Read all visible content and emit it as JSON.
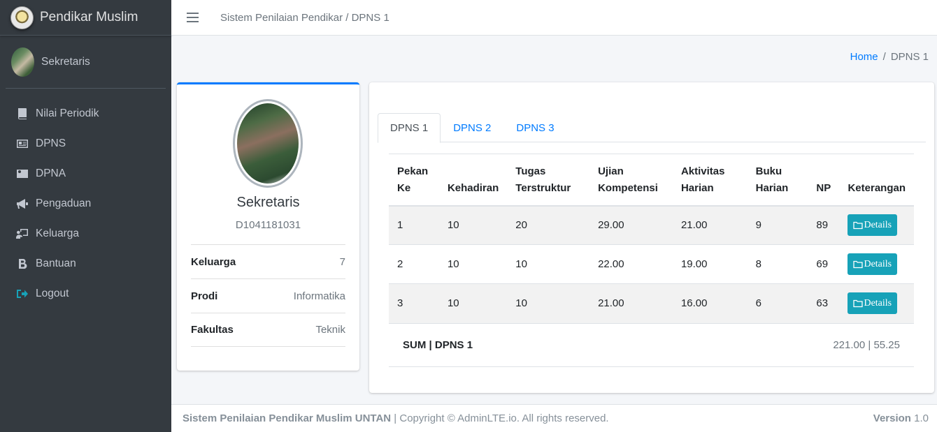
{
  "brand": {
    "name": "Pendikar Muslim",
    "logo_icon": "university-seal-icon"
  },
  "user_panel": {
    "name": "Sekretaris"
  },
  "sidebar": {
    "items": [
      {
        "label": "Nilai Periodik",
        "icon": "book-icon"
      },
      {
        "label": "DPNS",
        "icon": "id-card-icon"
      },
      {
        "label": "DPNA",
        "icon": "id-badge-icon"
      },
      {
        "label": "Pengaduan",
        "icon": "bullhorn-icon"
      },
      {
        "label": "Keluarga",
        "icon": "chalkboard-user-icon"
      },
      {
        "label": "Bantuan",
        "icon": "bold-b-icon"
      },
      {
        "label": "Logout",
        "icon": "sign-out-icon"
      }
    ]
  },
  "topbar": {
    "title": "Sistem Penilaian Pendikar / DPNS 1"
  },
  "breadcrumb": {
    "home": "Home",
    "separator": "/",
    "current": "DPNS 1"
  },
  "profile": {
    "name": "Sekretaris",
    "id": "D1041181031",
    "rows": [
      {
        "key": "Keluarga",
        "value": "7"
      },
      {
        "key": "Prodi",
        "value": "Informatika"
      },
      {
        "key": "Fakultas",
        "value": "Teknik"
      }
    ]
  },
  "tabs": [
    {
      "label": "DPNS 1",
      "active": true
    },
    {
      "label": "DPNS 2",
      "active": false
    },
    {
      "label": "DPNS 3",
      "active": false
    }
  ],
  "table": {
    "headers": [
      "Pekan Ke",
      "Kehadiran",
      "Tugas Terstruktur",
      "Ujian Kompetensi",
      "Aktivitas Harian",
      "Buku Harian",
      "NP",
      "Keterangan"
    ],
    "header_lines": [
      [
        "Pekan",
        "Ke"
      ],
      [
        "",
        "Kehadiran"
      ],
      [
        "Tugas",
        "Terstruktur"
      ],
      [
        "Ujian",
        "Kompetensi"
      ],
      [
        "Aktivitas",
        "Harian"
      ],
      [
        "Buku",
        "Harian"
      ],
      [
        "",
        "NP"
      ],
      [
        "",
        "Keterangan"
      ]
    ],
    "rows": [
      {
        "pekan": "1",
        "kehadiran": "10",
        "tugas": "20",
        "ujian": "29.00",
        "aktivitas": "21.00",
        "buku": "9",
        "np": "89",
        "button": "Details"
      },
      {
        "pekan": "2",
        "kehadiran": "10",
        "tugas": "10",
        "ujian": "22.00",
        "aktivitas": "19.00",
        "buku": "8",
        "np": "69",
        "button": "Details"
      },
      {
        "pekan": "3",
        "kehadiran": "10",
        "tugas": "10",
        "ujian": "21.00",
        "aktivitas": "16.00",
        "buku": "6",
        "np": "63",
        "button": "Details"
      }
    ]
  },
  "sum": {
    "label": "SUM | DPNS 1",
    "value": "221.00 | 55.25"
  },
  "footer": {
    "strong": "Sistem Penilaian Pendikar Muslim UNTAN",
    "rest": " | Copyright © AdminLTE.io. All rights reserved.",
    "version_label": "Version",
    "version_value": " 1.0"
  },
  "colors": {
    "accent": "#007bff",
    "info": "#17a2b8",
    "sidebar_bg": "#343a40"
  }
}
